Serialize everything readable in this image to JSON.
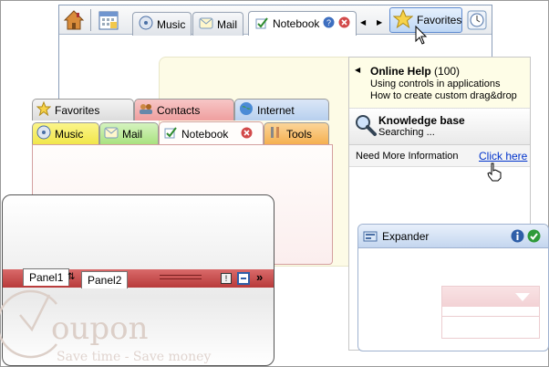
{
  "top_tabs": {
    "items": [
      {
        "label": "Music"
      },
      {
        "label": "Mail"
      },
      {
        "label": "Notebook"
      }
    ],
    "favorites_label": "Favorites"
  },
  "right_panel": {
    "help_title": "Online Help",
    "help_count": "(100)",
    "help_line1": "Using controls in applications",
    "help_line2": "How to create custom drag&drop",
    "kb_title": "Knowledge base",
    "kb_status": "Searching ...",
    "more_label": "Need More Information",
    "more_link": "Click here"
  },
  "expander": {
    "title": "Expander"
  },
  "color_tabs": {
    "row1": [
      {
        "label": "Favorites"
      },
      {
        "label": "Contacts"
      },
      {
        "label": "Internet"
      }
    ],
    "row2": [
      {
        "label": "Music"
      },
      {
        "label": "Mail"
      },
      {
        "label": "Notebook"
      },
      {
        "label": "Tools"
      }
    ]
  },
  "panels": {
    "tabs": [
      {
        "label": "Panel1"
      },
      {
        "label": "Panel2"
      }
    ]
  },
  "logo": {
    "wordmark": "oupon",
    "tagline": "Save time - Save money"
  },
  "colors": {
    "accent_blue": "#5e8ad0",
    "panel_red": "#c04848",
    "help_yellow": "#fefde7"
  }
}
